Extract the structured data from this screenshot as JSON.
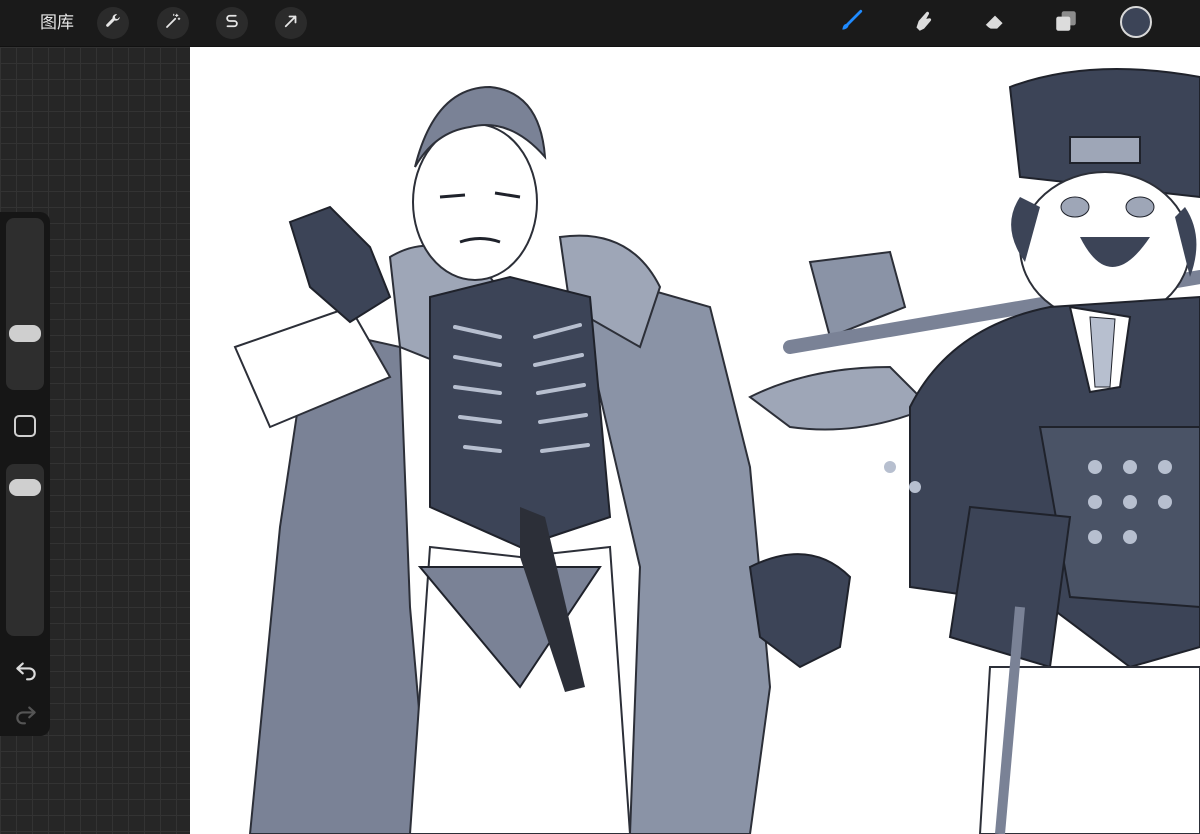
{
  "toolbar": {
    "gallery_label": "图库",
    "actions_icon": "wrench-icon",
    "adjustments_icon": "magic-wand-icon",
    "selection_icon": "selection-s-icon",
    "transform_icon": "arrow-cursor-icon",
    "brush_icon": "brush-icon",
    "smudge_icon": "smudge-finger-icon",
    "eraser_icon": "eraser-icon",
    "layers_icon": "layers-icon",
    "active_tool": "brush",
    "active_color": "#3c4457",
    "accent_color": "#1f8bff"
  },
  "sidebar": {
    "brush_size_level": 0.3,
    "opacity_level": 0.92,
    "modify_icon": "square-icon",
    "undo_icon": "undo-arrow-icon",
    "redo_icon": "redo-arrow-icon"
  },
  "canvas": {
    "content": "sketch",
    "palette": [
      "#3c4457",
      "#7a8296",
      "#b7bfcf",
      "#ffffff"
    ]
  }
}
